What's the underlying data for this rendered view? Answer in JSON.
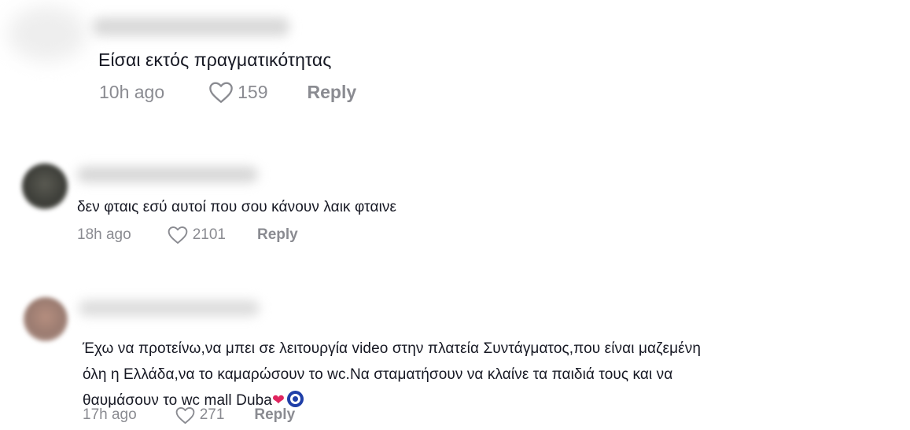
{
  "comments": [
    {
      "text": "Είσαι εκτός πραγματικότητας",
      "time": "10h ago",
      "likes": "159",
      "reply_label": "Reply"
    },
    {
      "text": "δεν φταις εσύ αυτοί που σου κάνουν λαικ φταινε",
      "time": "18h ago",
      "likes": "2101",
      "reply_label": "Reply"
    },
    {
      "text_parts": {
        "line1_a": "Έχω να προτείνω,να μπει σε λειτουργία ",
        "line1_b": "video",
        "line1_c": " στην πλατεία Συντάγματος,που είναι μαζεμένη",
        "line2_a": "όλη η Ελλάδα,να το καμαρώσουν το ",
        "line2_b": "wc.",
        "line2_c": "Να σταματήσουν να κλαίνε τα παιδιά τους και να",
        "line3_a": "θαυμάσουν το ",
        "line3_b": "wc mall Duba",
        "heart": "❤"
      },
      "time": "17h ago",
      "likes": "271",
      "reply_label": "Reply"
    }
  ],
  "icons": {
    "like": "heart-outline-icon",
    "emoji_heart": "red-heart-emoji",
    "emoji_nazar": "nazar-amulet-emoji"
  },
  "colors": {
    "text": "#161823",
    "meta": "#8a8b91",
    "emoji_heart": "#e0245e",
    "nazar": "#1f3fa8"
  }
}
